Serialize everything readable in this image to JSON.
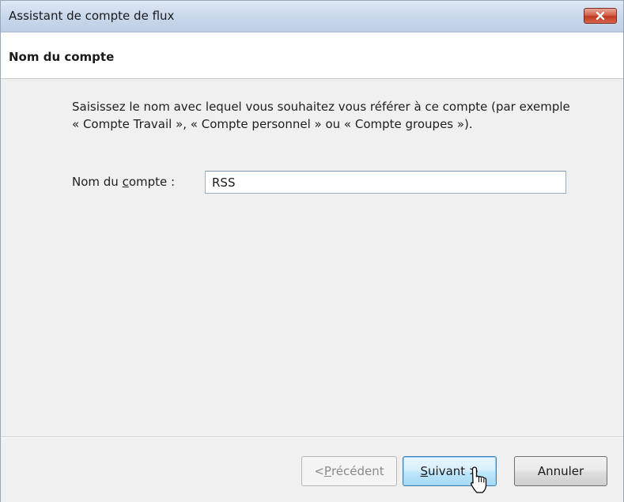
{
  "window": {
    "title": "Assistant de compte de flux"
  },
  "header": {
    "title": "Nom du compte"
  },
  "content": {
    "description": "Saisissez le nom avec lequel vous souhaitez vous référer à ce compte (par exemple « Compte Travail », « Compte personnel » ou « Compte groupes »).",
    "field_label_before": "Nom du ",
    "field_label_mnemonic": "c",
    "field_label_after": "ompte :",
    "field_value": "RSS"
  },
  "buttons": {
    "prev_before": "< ",
    "prev_mnemonic": "P",
    "prev_after": "récédent",
    "next_mnemonic": "S",
    "next_after": "uivant >",
    "cancel_label": "Annuler"
  },
  "icons": {
    "close": "close-icon",
    "cursor": "mouse-pointer-icon"
  },
  "colors": {
    "close_button": "#c0391f",
    "title_bar": "#c9d8eb",
    "next_button_border": "#3c7fb1"
  }
}
